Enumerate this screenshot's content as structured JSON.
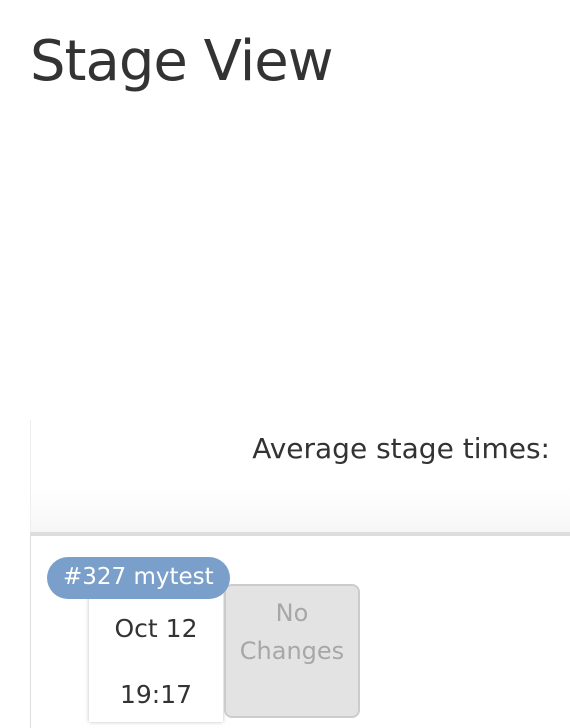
{
  "page": {
    "title": "Stage View"
  },
  "stage_view": {
    "average_label": "Average stage times:",
    "builds": [
      {
        "badge": "#327 mytest",
        "date": "Oct 12",
        "time": "19:17",
        "changes": "No Changes"
      }
    ]
  },
  "colors": {
    "badge_bg": "#7a9fcb",
    "no_changes_bg": "#e3e3e3",
    "text": "#333333"
  }
}
